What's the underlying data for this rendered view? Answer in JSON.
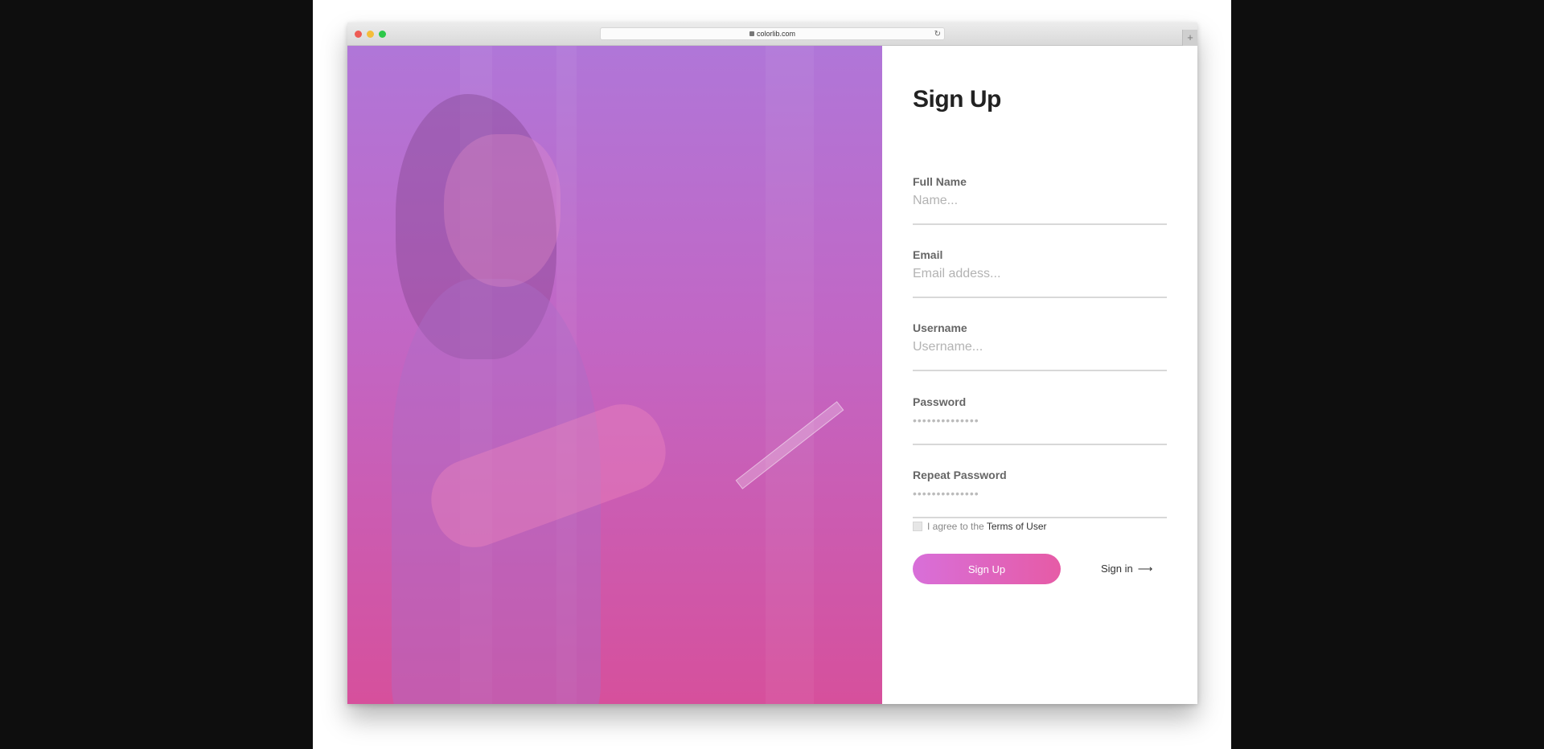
{
  "browser": {
    "url": "colorlib.com",
    "reload_icon": "reload-icon",
    "new_tab_label": "+"
  },
  "form": {
    "title": "Sign Up",
    "fields": [
      {
        "label": "Full Name",
        "placeholder": "Name..."
      },
      {
        "label": "Email",
        "placeholder": "Email addess..."
      },
      {
        "label": "Username",
        "placeholder": "Username..."
      },
      {
        "label": "Password",
        "placeholder": "••••••••••••••"
      },
      {
        "label": "Repeat Password",
        "placeholder": "••••••••••••••"
      }
    ],
    "agree_text": "I agree to the ",
    "terms_link": "Terms of User",
    "submit_label": "Sign Up",
    "signin_label": "Sign in",
    "signin_arrow": "⟶"
  },
  "colors": {
    "hero_top": "#b076d8",
    "hero_bottom": "#d6509c",
    "button_start": "#d86fd9",
    "button_end": "#e65ba6"
  }
}
